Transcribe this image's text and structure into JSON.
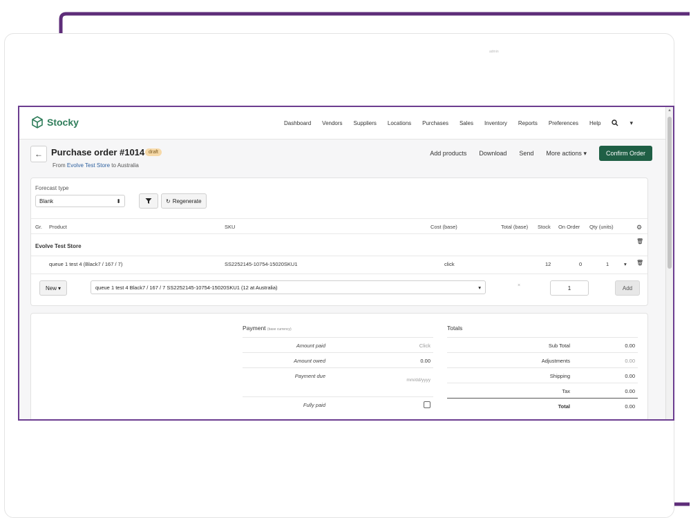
{
  "colors": {
    "frame_purple": "#5e2d79",
    "brand_green": "#2f7d5a",
    "confirm_green": "#1f5f45",
    "draft_badge_bg": "#f6d9a8",
    "link_blue": "#2c5f9e"
  },
  "browser": {
    "tab_label": "admin"
  },
  "app": {
    "logo_text": "Stocky",
    "logo_icon": "box-icon",
    "nav": [
      "Dashboard",
      "Vendors",
      "Suppliers",
      "Locations",
      "Purchases",
      "Sales",
      "Inventory",
      "Reports",
      "Preferences",
      "Help"
    ],
    "search_icon": "search-icon",
    "dropdown_icon": "chevron-down-icon"
  },
  "order": {
    "back_icon": "arrow-left-icon",
    "title": "Purchase order #1014",
    "status_badge": "draft",
    "from_prefix": "From",
    "from_store": "Evolve Test Store",
    "to_text": "to Australia",
    "actions": {
      "add_products": "Add products",
      "download": "Download",
      "send": "Send",
      "more_actions": "More actions",
      "confirm": "Confirm Order"
    }
  },
  "forecast": {
    "label": "Forecast type",
    "selected": "Blank",
    "regenerate_label": "Regenerate"
  },
  "table": {
    "headers": {
      "gr": "Gr.",
      "product": "Product",
      "sku": "SKU",
      "cost": "Cost (base)",
      "total": "Total (base)",
      "stock": "Stock",
      "on_order": "On Order",
      "qty": "Qty (units)"
    },
    "group_name": "Evolve Test Store",
    "rows": [
      {
        "product": "queue 1 test 4 (Black7 / 167 / 7)",
        "sku": "SS2252145-10754-15020SKU1",
        "cost": "click",
        "total": "",
        "stock": "12",
        "on_order": "0",
        "qty": "1"
      }
    ],
    "add_row": {
      "new_label": "New",
      "product_select": "queue 1 test 4 Black7 / 167 / 7 SS2252145-10754-15020SKU1 (12 at Australia)",
      "x_mark": "×",
      "qty_value": "1",
      "add_label": "Add"
    }
  },
  "payment": {
    "title": "Payment",
    "subtitle": "(base currency)",
    "amount_paid_label": "Amount paid",
    "amount_paid_value": "Click",
    "amount_owed_label": "Amount owed",
    "amount_owed_value": "0.00",
    "payment_due_label": "Payment due",
    "payment_due_placeholder": "mm/dd/yyyy",
    "fully_paid_label": "Fully paid",
    "fully_paid_checked": false
  },
  "totals": {
    "title": "Totals",
    "sub_total_label": "Sub Total",
    "sub_total_value": "0.00",
    "adjustments_label": "Adjustments",
    "adjustments_value": "0.00",
    "shipping_label": "Shipping",
    "shipping_value": "0.00",
    "tax_label": "Tax",
    "tax_value": "0.00",
    "total_label": "Total",
    "total_value": "0.00"
  }
}
